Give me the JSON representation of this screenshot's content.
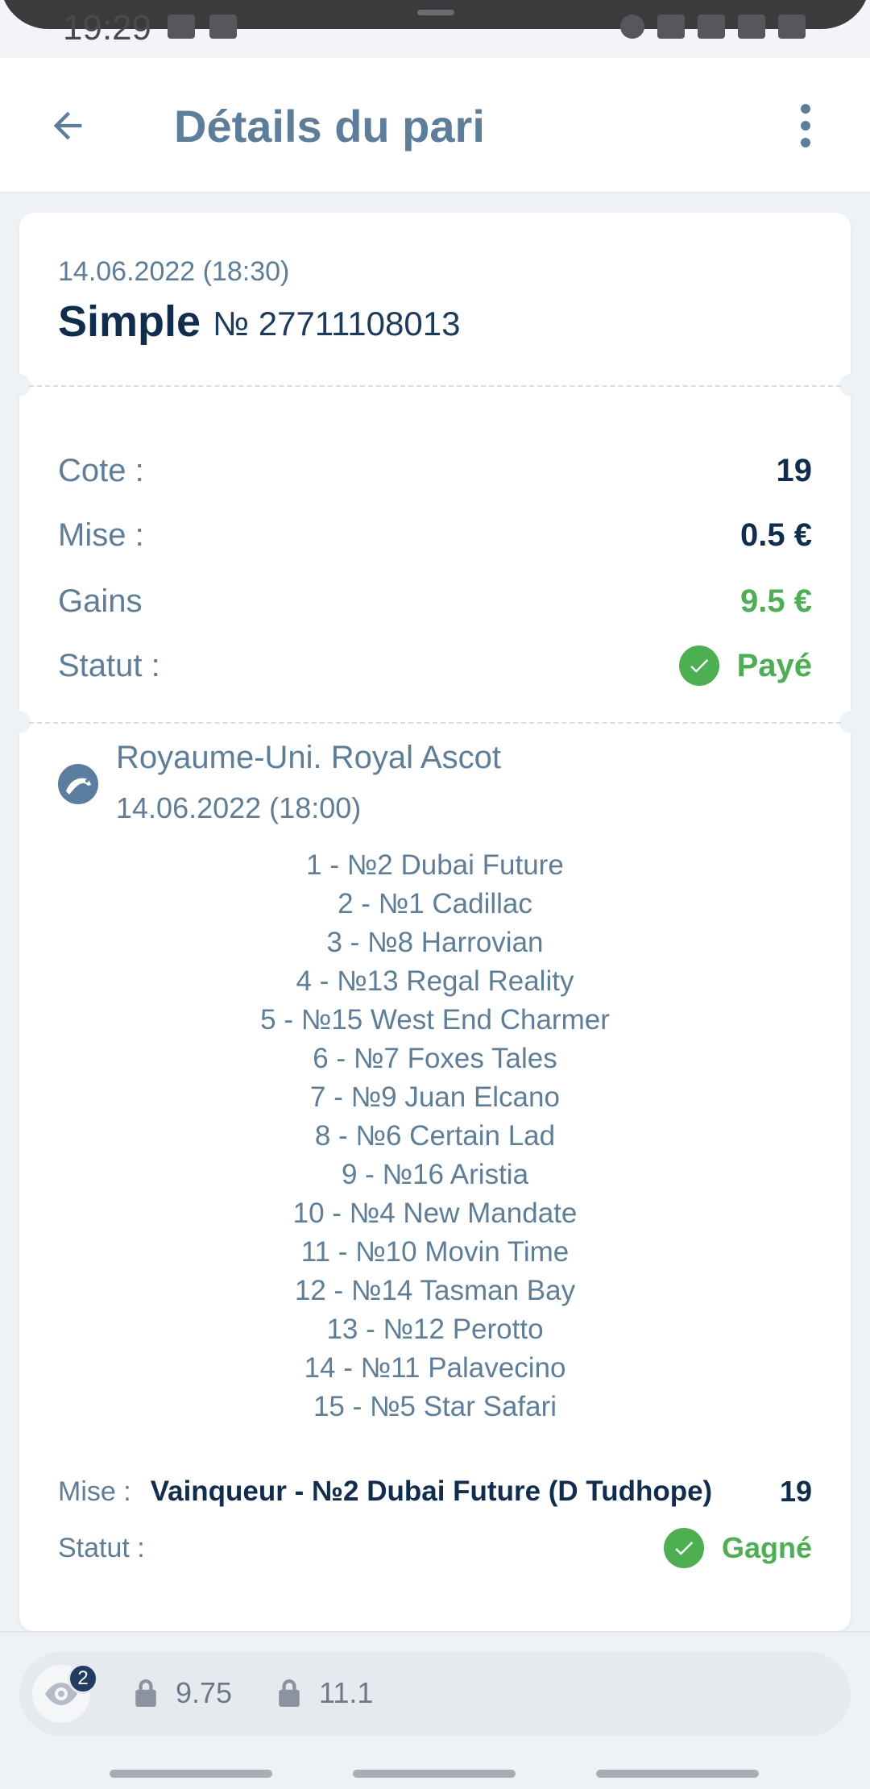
{
  "status_bar": {
    "time": "19:29"
  },
  "app_bar": {
    "title": "Détails du pari",
    "back_icon": "arrow-left-icon",
    "more_icon": "more-vertical-icon"
  },
  "bet": {
    "date": "14.06.2022 (18:30)",
    "type": "Simple",
    "number": "№ 27711108013",
    "summary": {
      "odds_label": "Cote :",
      "odds_value": "19",
      "stake_label": "Mise :",
      "stake_value": "0.5 €",
      "winnings_label": "Gains",
      "winnings_value": "9.5 €",
      "status_label": "Statut :",
      "status_value": "Payé"
    }
  },
  "event": {
    "icon": "horse-racing-icon",
    "name": "Royaume-Uni. Royal Ascot",
    "date": "14.06.2022 (18:00)",
    "runners": [
      "1 - №2 Dubai Future",
      "2 - №1 Cadillac",
      "3 - №8 Harrovian",
      "4 - №13 Regal Reality",
      "5 - №15 West End Charmer",
      "6 - №7 Foxes Tales",
      "7 - №9 Juan Elcano",
      "8 - №6 Certain Lad",
      "9 - №16 Aristia",
      "10 - №4 New Mandate",
      "11 - №10 Movin Time",
      "12 - №14 Tasman Bay",
      "13 - №12 Perotto",
      "14 - №11 Palavecino",
      "15 - №5 Star Safari"
    ],
    "selection": {
      "label": "Mise :",
      "text": "Vainqueur - №2 Dubai Future (D Tudhope)",
      "odds": "19",
      "status_label": "Statut :",
      "status_value": "Gagné"
    }
  },
  "bottom_tray": {
    "eye_badge": "2",
    "lock_values": [
      "9.75",
      "11.1"
    ]
  },
  "colors": {
    "accent": "#5d7e9a",
    "dark": "#0f2d4e",
    "green": "#4caf50"
  }
}
